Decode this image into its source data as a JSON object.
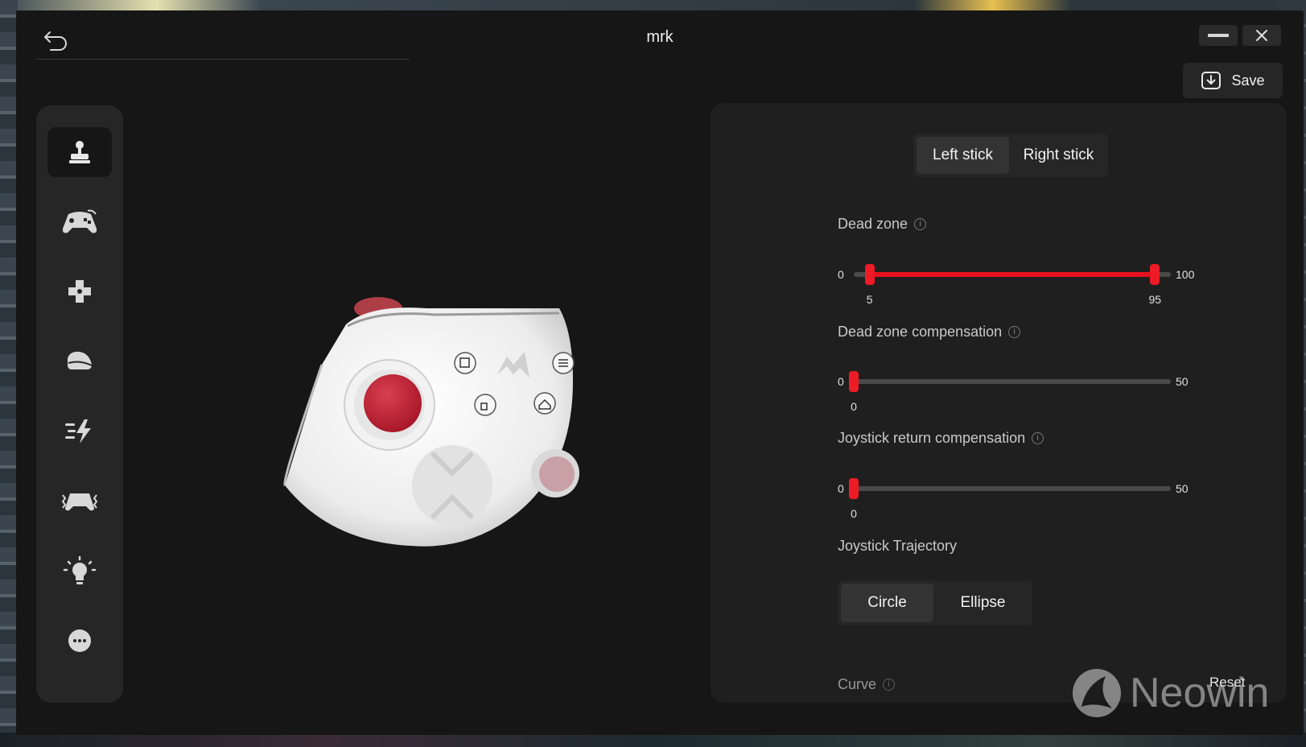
{
  "window": {
    "title": "mrk"
  },
  "toolbar": {
    "save_label": "Save"
  },
  "sidebar": {
    "items": [
      {
        "name": "joystick",
        "icon": "joystick-icon",
        "active": true
      },
      {
        "name": "buttons",
        "icon": "gamepad-icon",
        "active": false
      },
      {
        "name": "dpad",
        "icon": "dpad-icon",
        "active": false
      },
      {
        "name": "triggers",
        "icon": "trigger-icon",
        "active": false
      },
      {
        "name": "turbo",
        "icon": "lightning-icon",
        "active": false
      },
      {
        "name": "vibration",
        "icon": "vibration-icon",
        "active": false
      },
      {
        "name": "lighting",
        "icon": "lightbulb-icon",
        "active": false
      },
      {
        "name": "more",
        "icon": "more-icon",
        "active": false
      }
    ]
  },
  "settings": {
    "stick_tabs": {
      "left": "Left stick",
      "right": "Right stick",
      "selected": "left"
    },
    "dead_zone": {
      "label": "Dead zone",
      "min": "0",
      "max": "100",
      "low_value": "5",
      "high_value": "95",
      "low": 5,
      "high": 95,
      "range": 100
    },
    "dead_zone_comp": {
      "label": "Dead zone compensation",
      "min": "0",
      "max": "50",
      "value_text": "0",
      "value": 0,
      "range": 50
    },
    "return_comp": {
      "label": "Joystick return compensation",
      "min": "0",
      "max": "50",
      "value_text": "0",
      "value": 0,
      "range": 50
    },
    "trajectory": {
      "label": "Joystick Trajectory",
      "circle": "Circle",
      "ellipse": "Ellipse",
      "selected": "circle"
    },
    "curve_label": "Curve",
    "reset_label": "Reset"
  },
  "watermark": {
    "text": "Neowin"
  },
  "colors": {
    "accent": "#e8111f",
    "panel": "#1f1f1f",
    "background": "#161616"
  }
}
